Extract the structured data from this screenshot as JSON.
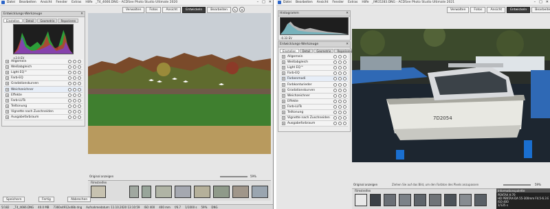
{
  "left": {
    "menu": [
      "Datei",
      "Bearbeiten",
      "Ansicht",
      "Fenster",
      "Extras",
      "Hilfe"
    ],
    "title": "_T4_4666.DNG - ACDSee Photo Studio Ultimate 2020",
    "modes": [
      "Verwalten",
      "Fotos",
      "Ansicht",
      "Entwickeln",
      "Bearbeiten"
    ],
    "active_mode": "Entwickeln",
    "panel_title": "Entwicklungs-Werkzeuge",
    "tabs": [
      "Einstellen",
      "Detail",
      "Geometrie",
      "Reparieren"
    ],
    "ev_label": "+2.0 EV",
    "filters": [
      "Allgemein",
      "Weißabgleich",
      "Light EQ™",
      "Farb-EQ",
      "Gradationskurven",
      "Weichzeichner",
      "Effekte",
      "Farb-LUTs",
      "Teiltonung",
      "Vignette nach Zuschneiden",
      "Ausgabefarbraum"
    ],
    "highlight_index": 5,
    "original_label": "Original anzeigen",
    "zoom": "59%",
    "filmstrip_label": "Filmstreifen",
    "save_label": "Speichern",
    "done_label": "Fertig",
    "cancel_label": "Abbrechen",
    "status": [
      "5/182",
      "_T4_4666.DNG",
      "40.0 MB",
      "7360x4912x48b dng",
      "Aufnahmedatum: 11.10.2020 13:10:59",
      "ISO 400",
      "400 mm",
      "f/6.7",
      "1/1000 s",
      "59%",
      "DNG"
    ]
  },
  "right": {
    "menu": [
      "Datei",
      "Bearbeiten",
      "Ansicht",
      "Fenster",
      "Extras",
      "Hilfe"
    ],
    "title": "_IMG5283.DNG - ACDSee Photo Studio Ultimate 2021",
    "modes": [
      "Verwalten",
      "Fotos",
      "Ansicht",
      "Entwickeln",
      "Bearbeiten"
    ],
    "active_mode": "Entwickeln",
    "histo_title": "Histogramm",
    "ev_label": "-0.33 EV",
    "panel_title": "Entwicklungs-Werkzeuge",
    "tabs": [
      "Einstellen",
      "Detail",
      "Geometrie",
      "Reparieren"
    ],
    "filters": [
      "Allgemein",
      "Weißabgleich",
      "Light EQ™",
      "Farb-EQ",
      "Farbenmodi",
      "Farbkonturieder",
      "Gradationskurven",
      "Weichzeichner",
      "Effekte",
      "Farb-LUTs",
      "Teiltonung",
      "Vignette nach Zuschneiden",
      "Ausgabefarbraum"
    ],
    "highlight_index": 4,
    "original_label": "Original anzeigen",
    "hint": "Ziehen Sie auf das Bild, um den Farbton des Pixels anzupassen",
    "zoom": "59%",
    "filmstrip_label": "Filmstreifen",
    "info_title": "Informationspalette",
    "info_lines": [
      "PENTAX K-70",
      "HD PENTAX-DA 55-300mm F4.5-6.3 ED PLM WR RE",
      "ISO 400",
      "1/125 s"
    ],
    "boat_text": "7D2054"
  }
}
